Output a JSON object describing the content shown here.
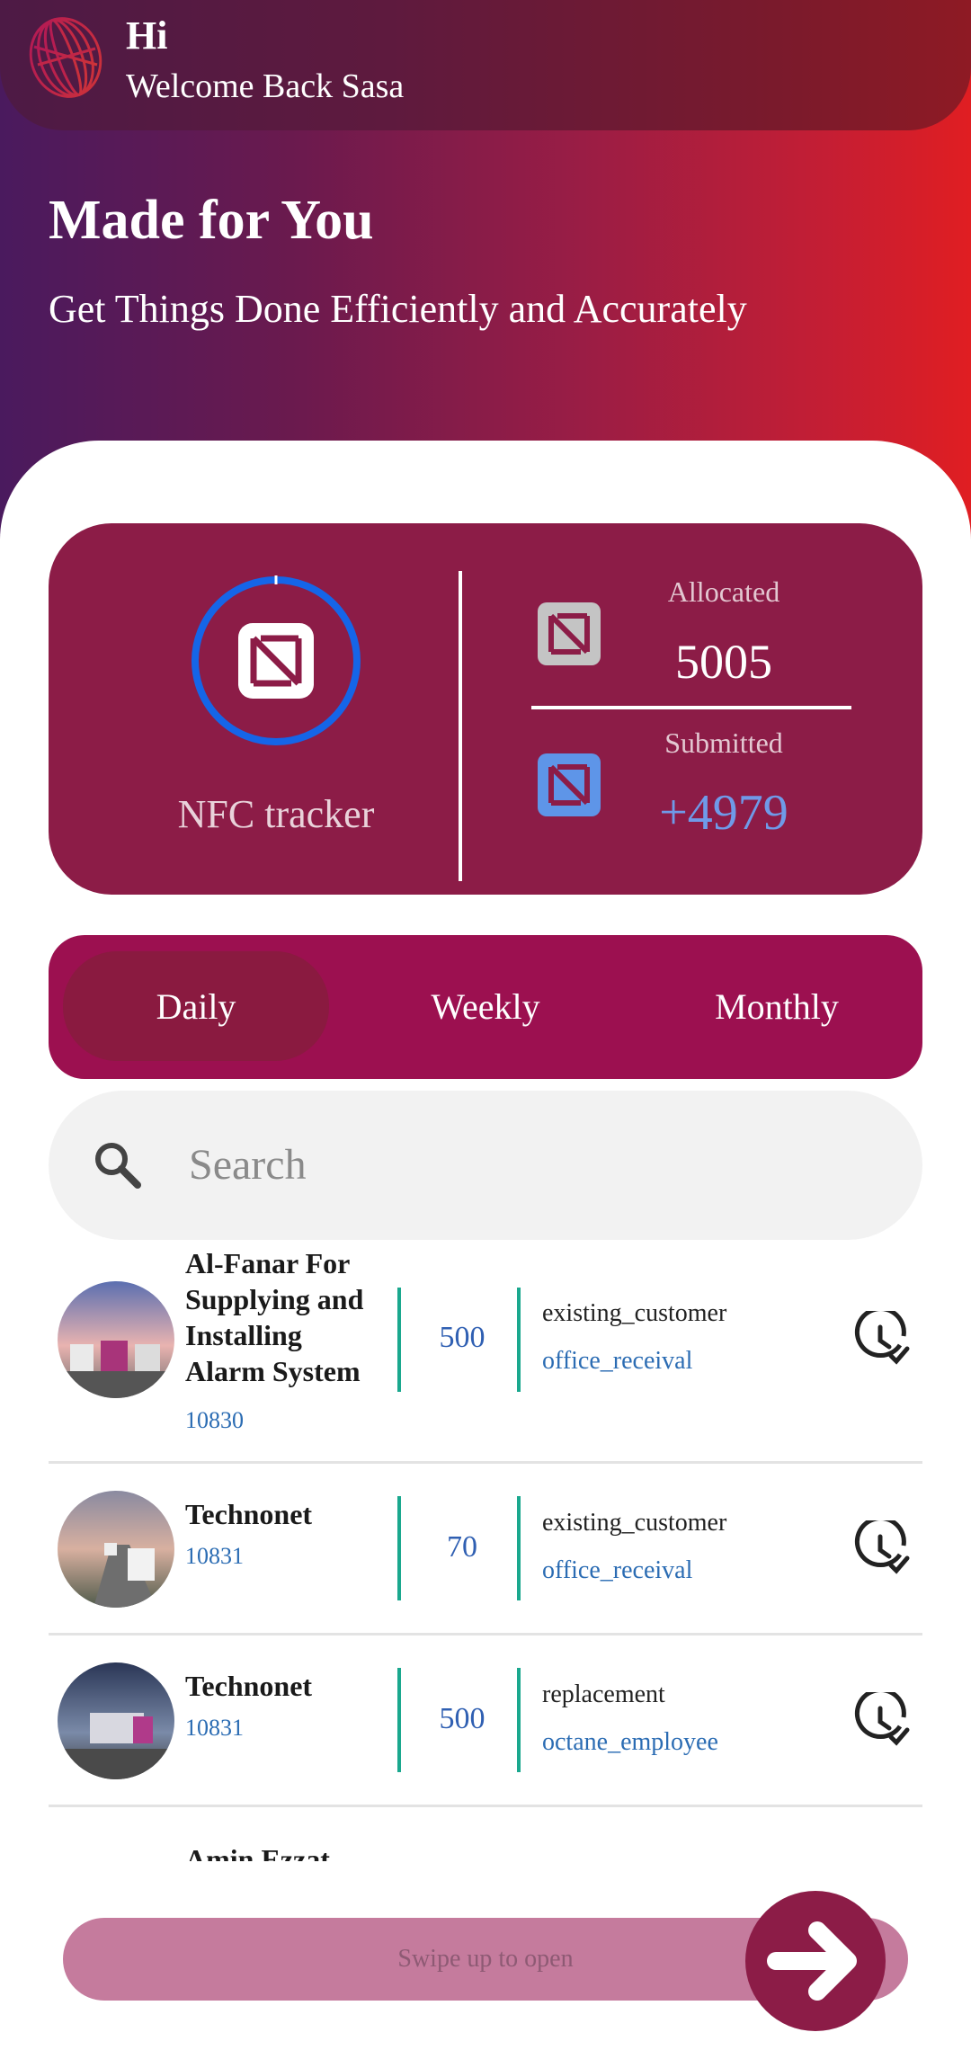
{
  "header": {
    "hi": "Hi",
    "welcome": "Welcome Back Sasa"
  },
  "hero": {
    "title": "Made for You",
    "subtitle": "Get Things Done Efficiently and Accurately"
  },
  "nfc": {
    "label": "NFC tracker",
    "allocated_label": "Allocated",
    "allocated_value": "5005",
    "submitted_label": "Submitted",
    "submitted_value": "+4979",
    "progress_fraction": 0.995
  },
  "period": {
    "tabs": [
      "Daily",
      "Weekly",
      "Monthly"
    ],
    "selected": "Daily"
  },
  "search": {
    "placeholder": "Search"
  },
  "rows": [
    {
      "name": "Al-Fanar For Supplying and Installing Alarm System",
      "id": "10830",
      "qty": "500",
      "type": "existing_customer",
      "source": "office_receival"
    },
    {
      "name": "Technonet",
      "id": "10831",
      "qty": "70",
      "type": "existing_customer",
      "source": "office_receival"
    },
    {
      "name": "Technonet",
      "id": "10831",
      "qty": "500",
      "type": "replacement",
      "source": "octane_employee"
    },
    {
      "name": "Amin Ezzat",
      "id": "",
      "qty": "",
      "type": "",
      "source": ""
    }
  ],
  "swipe": {
    "label": "Swipe up to open"
  },
  "colors": {
    "card": "#8c1c47",
    "period_bar": "#9c1050",
    "accent_blue": "#6f9ae8",
    "teal": "#1aa88e"
  }
}
